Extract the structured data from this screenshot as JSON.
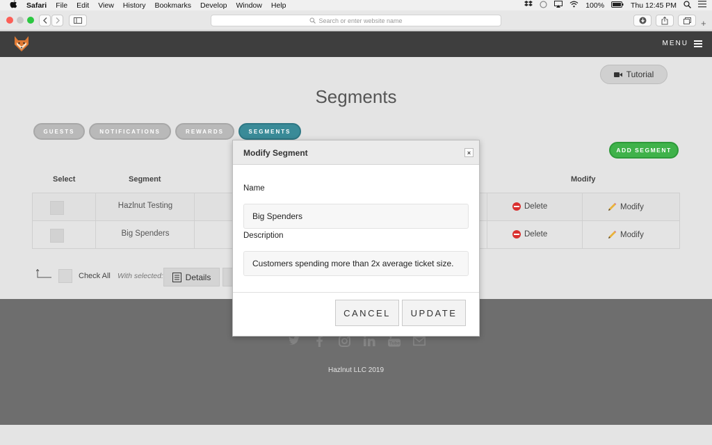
{
  "menubar": {
    "app_name": "Safari",
    "items": [
      "File",
      "Edit",
      "View",
      "History",
      "Bookmarks",
      "Develop",
      "Window",
      "Help"
    ],
    "battery": "100%",
    "clock": "Thu 12:45 PM"
  },
  "browser": {
    "address_placeholder": "Search or enter website name"
  },
  "app": {
    "menu_label": "MENU"
  },
  "page": {
    "tutorial_label": "Tutorial",
    "title": "Segments",
    "tabs": [
      {
        "label": "GUESTS",
        "active": false
      },
      {
        "label": "NOTIFICATIONS",
        "active": false
      },
      {
        "label": "REWARDS",
        "active": false
      },
      {
        "label": "SEGMENTS",
        "active": true
      }
    ],
    "add_segment_label": "ADD SEGMENT",
    "columns": {
      "select": "Select",
      "segment": "Segment",
      "modify": "Modify"
    },
    "rows": [
      {
        "segment": "Hazlnut Testing",
        "delete": "Delete",
        "modify": "Modify"
      },
      {
        "segment": "Big Spenders",
        "delete": "Delete",
        "modify": "Modify"
      }
    ],
    "check_all": "Check All",
    "with_selected": "With selected:",
    "details_label": "Details"
  },
  "footer": {
    "copyright": "Hazlnut LLC 2019"
  },
  "modal": {
    "title": "Modify Segment",
    "close_glyph": "×",
    "name_label": "Name",
    "name_value": "Big Spenders",
    "description_label": "Description",
    "description_value": "Customers spending more than 2x average ticket size.",
    "cancel_label": "CANCEL",
    "update_label": "UPDATE"
  },
  "colors": {
    "active_tab": "#3a8b98",
    "add_button": "#3fb24a",
    "delete_icon": "#d9302f",
    "header_bg": "#3e3e3e",
    "footer_bg": "#6e6e6e"
  }
}
